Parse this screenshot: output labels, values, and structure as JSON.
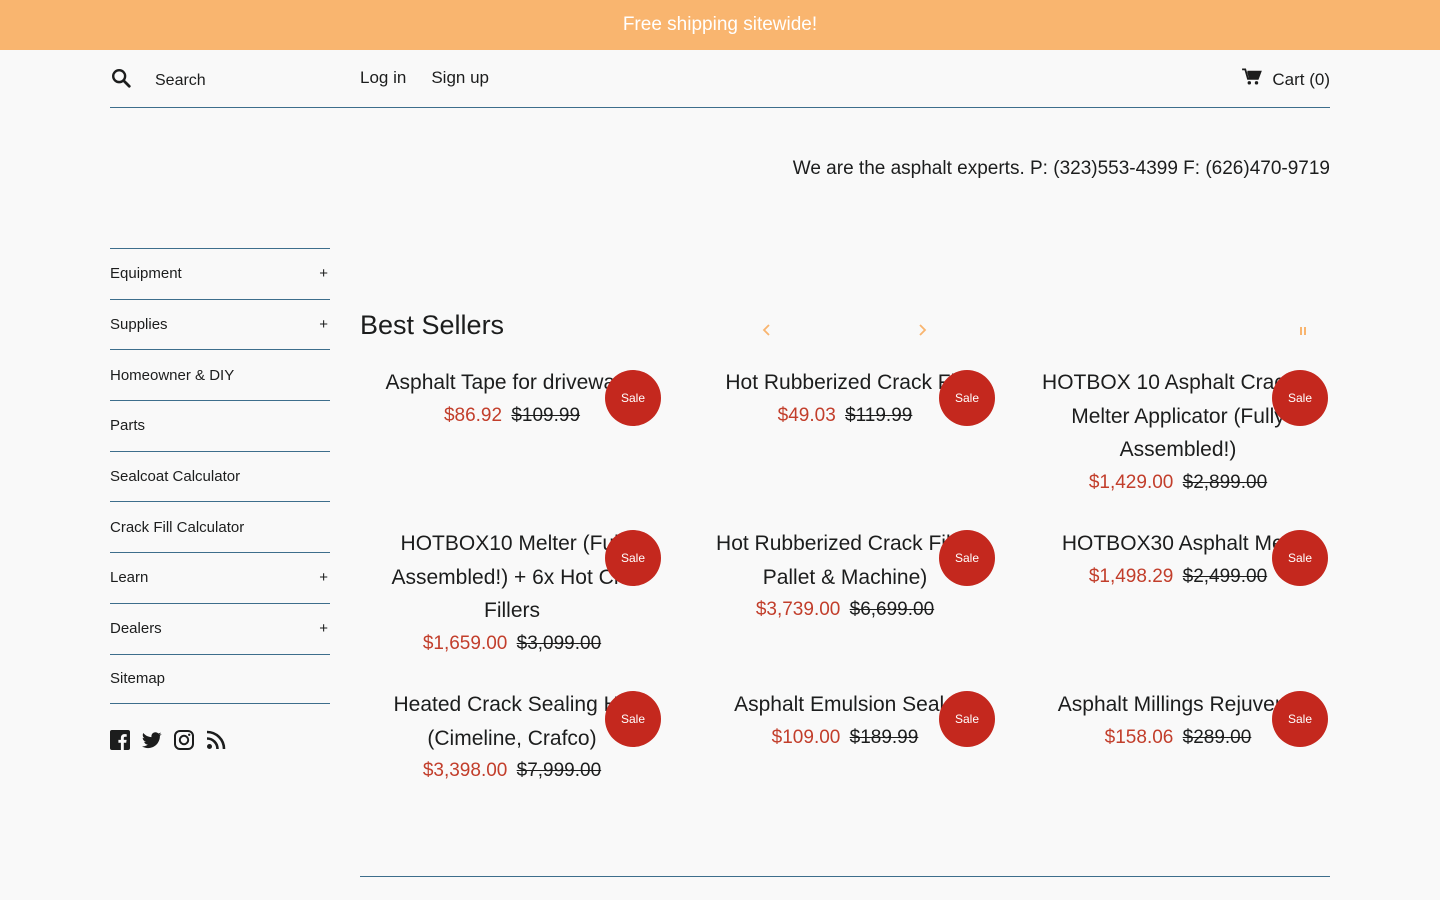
{
  "announcement": {
    "text": "Free shipping sitewide!"
  },
  "header": {
    "search_placeholder": "Search",
    "login": "Log in",
    "signup": "Sign up",
    "cart": "Cart (0)"
  },
  "tagline": "We are the asphalt experts. P: (323)553-4399 F: (626)470-9719",
  "sidebar": {
    "items": [
      {
        "label": "Equipment",
        "expand": "+"
      },
      {
        "label": "Supplies",
        "expand": "+"
      },
      {
        "label": "Homeowner & DIY",
        "expand": ""
      },
      {
        "label": "Parts",
        "expand": ""
      },
      {
        "label": "Sealcoat Calculator",
        "expand": ""
      },
      {
        "label": "Crack Fill Calculator",
        "expand": ""
      },
      {
        "label": "Learn",
        "expand": "+"
      },
      {
        "label": "Dealers",
        "expand": "+"
      },
      {
        "label": "Sitemap",
        "expand": ""
      }
    ],
    "social": [
      "facebook-icon",
      "twitter-icon",
      "instagram-icon",
      "rss-icon"
    ]
  },
  "best_sellers": {
    "title": "Best Sellers",
    "accent_color": "#f9b56f",
    "sale_color": "#c23e2b",
    "products": [
      {
        "title": "Asphalt Tape for driveway r",
        "sale_price": "$86.92",
        "orig_price": "$109.99",
        "badge": "Sale"
      },
      {
        "title": "Hot Rubberized Crack Fill",
        "sale_price": "$49.03",
        "orig_price": "$119.99",
        "badge": "Sale"
      },
      {
        "title": "HOTBOX 10 Asphalt Crack F Melter Applicator (Fully Assembled!)",
        "sale_price": "$1,429.00",
        "orig_price": "$2,899.00",
        "badge": "Sale"
      },
      {
        "title": "HOTBOX10 Melter (Full Assembled!) + 6x Hot Cra Fillers",
        "sale_price": "$1,659.00",
        "orig_price": "$3,099.00",
        "badge": "Sale"
      },
      {
        "title": "Hot Rubberized Crack Filler Pallet & Machine)",
        "sale_price": "$3,739.00",
        "orig_price": "$6,699.00",
        "badge": "Sale"
      },
      {
        "title": "HOTBOX30 Asphalt Melt",
        "sale_price": "$1,498.29",
        "orig_price": "$2,499.00",
        "badge": "Sale"
      },
      {
        "title": "Heated Crack Sealing Ho (Cimeline, Crafco)",
        "sale_price": "$3,398.00",
        "orig_price": "$7,999.00",
        "badge": "Sale"
      },
      {
        "title": "Asphalt Emulsion Seale",
        "sale_price": "$109.00",
        "orig_price": "$189.99",
        "badge": "Sale"
      },
      {
        "title": "Asphalt Millings Rejuvena",
        "sale_price": "$158.06",
        "orig_price": "$289.00",
        "badge": "Sale"
      }
    ]
  }
}
